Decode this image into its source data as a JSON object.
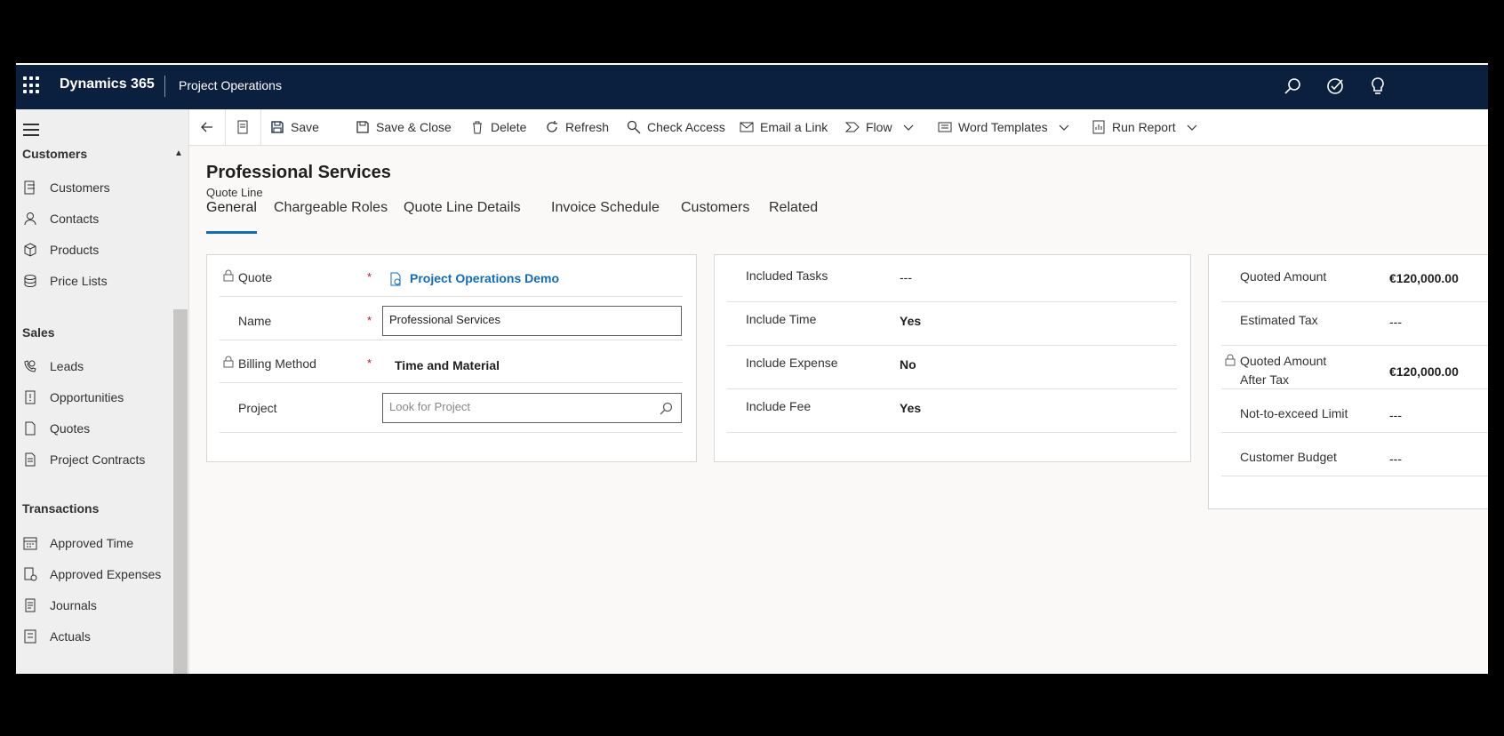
{
  "topbar": {
    "brand": "Dynamics 365",
    "app_name": "Project Operations",
    "icons": [
      "search-icon",
      "task-check-icon",
      "lightbulb-icon"
    ]
  },
  "sidebar": {
    "groups": [
      {
        "title": "Customers",
        "items": [
          {
            "label": "Customers",
            "icon": "customers-icon"
          },
          {
            "label": "Contacts",
            "icon": "person-icon"
          },
          {
            "label": "Products",
            "icon": "cube-icon"
          },
          {
            "label": "Price Lists",
            "icon": "database-icon"
          }
        ]
      },
      {
        "title": "Sales",
        "items": [
          {
            "label": "Leads",
            "icon": "phone-person-icon"
          },
          {
            "label": "Opportunities",
            "icon": "alert-doc-icon"
          },
          {
            "label": "Quotes",
            "icon": "document-icon"
          },
          {
            "label": "Project Contracts",
            "icon": "contract-icon"
          }
        ]
      },
      {
        "title": "Transactions",
        "items": [
          {
            "label": "Approved Time",
            "icon": "calendar-icon"
          },
          {
            "label": "Approved Expenses",
            "icon": "expense-icon"
          },
          {
            "label": "Journals",
            "icon": "journal-icon"
          },
          {
            "label": "Actuals",
            "icon": "actuals-icon"
          }
        ]
      }
    ]
  },
  "commandbar": {
    "save": "Save",
    "save_close": "Save & Close",
    "delete": "Delete",
    "refresh": "Refresh",
    "check_access": "Check Access",
    "email_link": "Email a Link",
    "flow": "Flow",
    "word_templates": "Word Templates",
    "run_report": "Run Report"
  },
  "record": {
    "title": "Professional Services",
    "entity": "Quote Line"
  },
  "tabs": [
    "General",
    "Chargeable Roles",
    "Quote Line Details",
    "Invoice Schedule",
    "Customers",
    "Related"
  ],
  "active_tab": "General",
  "section1": {
    "quote_label": "Quote",
    "quote_value": "Project Operations Demo",
    "name_label": "Name",
    "name_value": "Professional Services",
    "billing_label": "Billing Method",
    "billing_value": "Time and Material",
    "project_label": "Project",
    "project_placeholder": "Look for Project",
    "required_mark": "*"
  },
  "section2": {
    "rows": [
      {
        "label": "Included Tasks",
        "value": "---"
      },
      {
        "label": "Include Time",
        "value": "Yes"
      },
      {
        "label": "Include Expense",
        "value": "No"
      },
      {
        "label": "Include Fee",
        "value": "Yes"
      }
    ]
  },
  "section3": {
    "quoted_amount_label": "Quoted Amount",
    "quoted_amount_value": "€120,000.00",
    "estimated_tax_label": "Estimated Tax",
    "estimated_tax_value": "---",
    "after_tax_label_1": "Quoted Amount",
    "after_tax_label_2": "After Tax",
    "after_tax_value": "€120,000.00",
    "nte_label": "Not-to-exceed Limit",
    "nte_value": "---",
    "budget_label": "Customer Budget",
    "budget_value": "---"
  },
  "colors": {
    "topbar": "#0b1f3e",
    "accent": "#0f6cbd",
    "required": "#a4262c"
  }
}
